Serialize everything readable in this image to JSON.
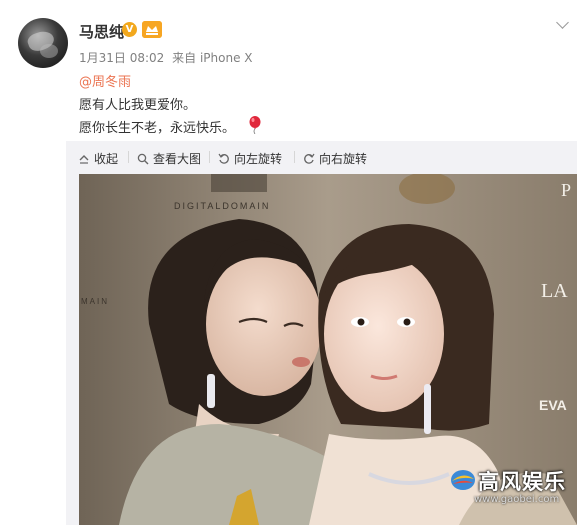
{
  "post": {
    "username": "马思纯",
    "verified_badge": "V",
    "date": "1月31日 08:02",
    "source": "来自 iPhone X",
    "mention": "@周冬雨",
    "line1": "愿有人比我更爱你。",
    "line2": "愿你长生不老，永远快乐。"
  },
  "toolbar": {
    "collapse": "收起",
    "view_large": "查看大图",
    "rotate_left": "向左旋转",
    "rotate_right": "向右旋转"
  },
  "photo": {
    "backdrop_text": [
      "DIGITALDOMAIN",
      "MAIN",
      "LA",
      "EVA",
      "P"
    ]
  },
  "watermark": {
    "title": "高风娱乐",
    "url": "www.gaobei.com"
  },
  "colors": {
    "mention": "#eb7350",
    "badge": "#f2a81d",
    "toolbar_bg": "#f2f2f5"
  }
}
